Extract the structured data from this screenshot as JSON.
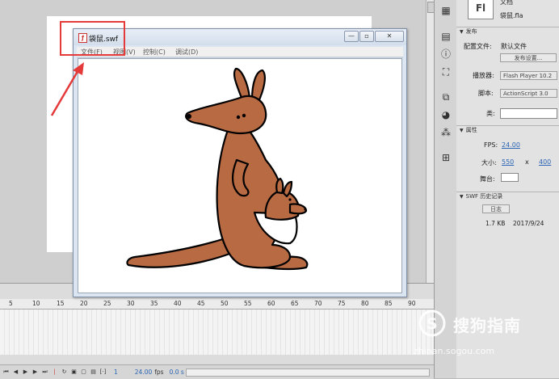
{
  "properties": {
    "doc_type": "文档",
    "app_badge": "Fl",
    "file_name": "袋鼠.fla",
    "publish_section": "发布",
    "profile_label": "配置文件:",
    "profile_value": "默认文件",
    "publish_settings_button": "发布设置...",
    "player_label": "播放器:",
    "player_value": "Flash Player 10.2",
    "script_label": "脚本:",
    "script_value": "ActionScript 3.0",
    "class_label": "类:",
    "attributes_section": "属性",
    "fps_label": "FPS:",
    "fps_value": "24.00",
    "size_label": "大小:",
    "width_value": "550",
    "size_sep": "x",
    "height_value": "400",
    "stage_label": "舞台:",
    "swf_history_section": "SWF 历史记录",
    "log_button": "日志",
    "swf_size": "1.7 KB",
    "swf_date": "2017/9/24"
  },
  "player_window": {
    "title": "袋鼠.swf",
    "menus": [
      "文件(F)",
      "视图(V)",
      "控制(C)",
      "调试(D)"
    ]
  },
  "timeline": {
    "ruler": [
      "5",
      "10",
      "15",
      "20",
      "25",
      "30",
      "35",
      "40",
      "45",
      "50",
      "55",
      "60",
      "65",
      "70",
      "75",
      "80",
      "85",
      "90"
    ],
    "frame": "1",
    "fps": "24.00",
    "fps_unit": "fps",
    "time": "0.0 s"
  },
  "watermark": {
    "text": "搜狗指南",
    "url": "zhinan.sogou.com"
  },
  "colors": {
    "highlight": "#e53a3a",
    "kangaroo": "#b86a43",
    "accent_blue": "#2a64b4"
  }
}
